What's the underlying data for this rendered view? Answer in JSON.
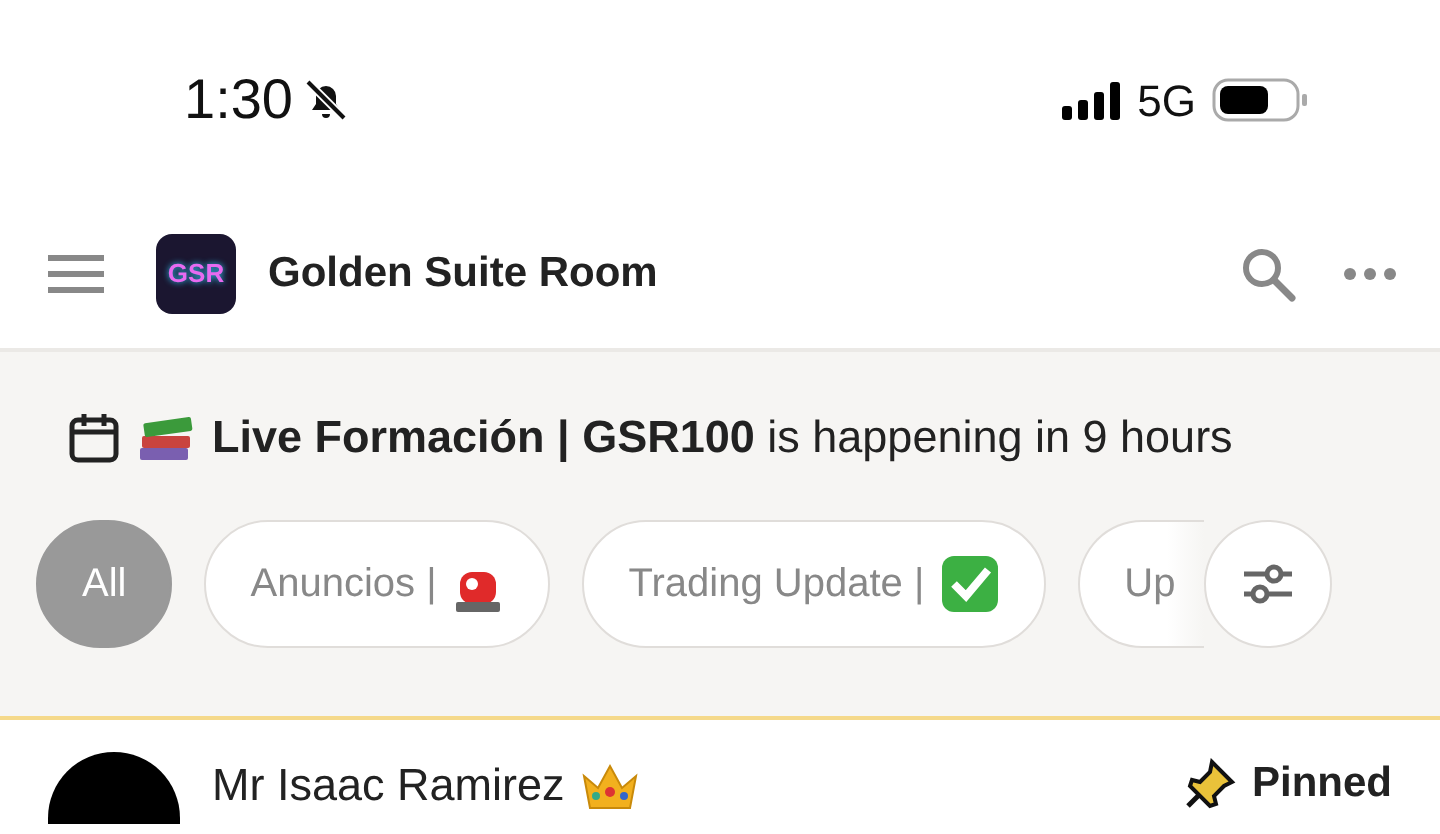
{
  "status_bar": {
    "time": "1:30",
    "muted": true,
    "network": "5G"
  },
  "app_bar": {
    "title": "Golden Suite Room",
    "logo_text": "GSR"
  },
  "event_banner": {
    "text": "**Live Formación | GSR100** is happening in 9 hours"
  },
  "filters": [
    {
      "label": "All",
      "selected": true,
      "kind": "plain"
    },
    {
      "label": "Anuncios |",
      "selected": false,
      "kind": "siren"
    },
    {
      "label": "Trading Update |",
      "selected": false,
      "kind": "check"
    },
    {
      "label": "Up",
      "selected": false,
      "kind": "cut"
    }
  ],
  "post": {
    "author": "Mr Isaac Ramirez",
    "pinned": true,
    "pinned_label": "Pinned"
  }
}
